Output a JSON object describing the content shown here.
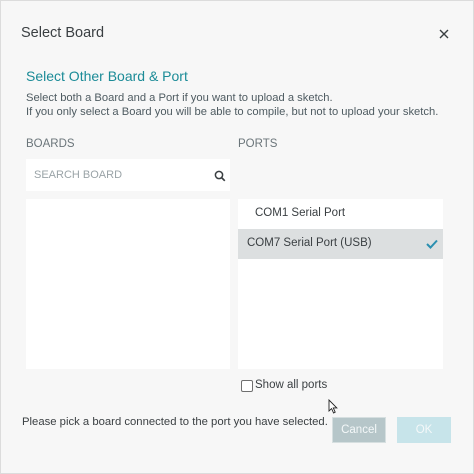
{
  "dialog": {
    "title": "Select Board",
    "close_icon": "close-icon"
  },
  "header": {
    "subtitle": "Select Other Board & Port",
    "description_line1": "Select both a Board and a Port if you want to upload a sketch.",
    "description_line2": "If you only select a Board you will be able to compile, but not to upload your sketch."
  },
  "boards": {
    "label": "BOARDS",
    "search_placeholder": "SEARCH BOARD",
    "search_value": "",
    "search_icon": "search-icon",
    "items": []
  },
  "ports": {
    "label": "PORTS",
    "items": [
      {
        "label": "COM1 Serial Port",
        "selected": false
      },
      {
        "label": "COM7 Serial Port (USB)",
        "selected": true
      }
    ],
    "selected_icon": "check-icon"
  },
  "show_all_ports": {
    "label": "Show all ports",
    "checked": false
  },
  "footer": {
    "message": "Please pick a board connected to the port you have selected.",
    "cancel_label": "Cancel",
    "ok_label": "OK"
  },
  "colors": {
    "accent": "#1b8b97",
    "selected_row": "#dcdfe0",
    "check": "#2a8fb0",
    "cancel_button": "#b6c6c9",
    "ok_button": "#c7e4ea"
  }
}
